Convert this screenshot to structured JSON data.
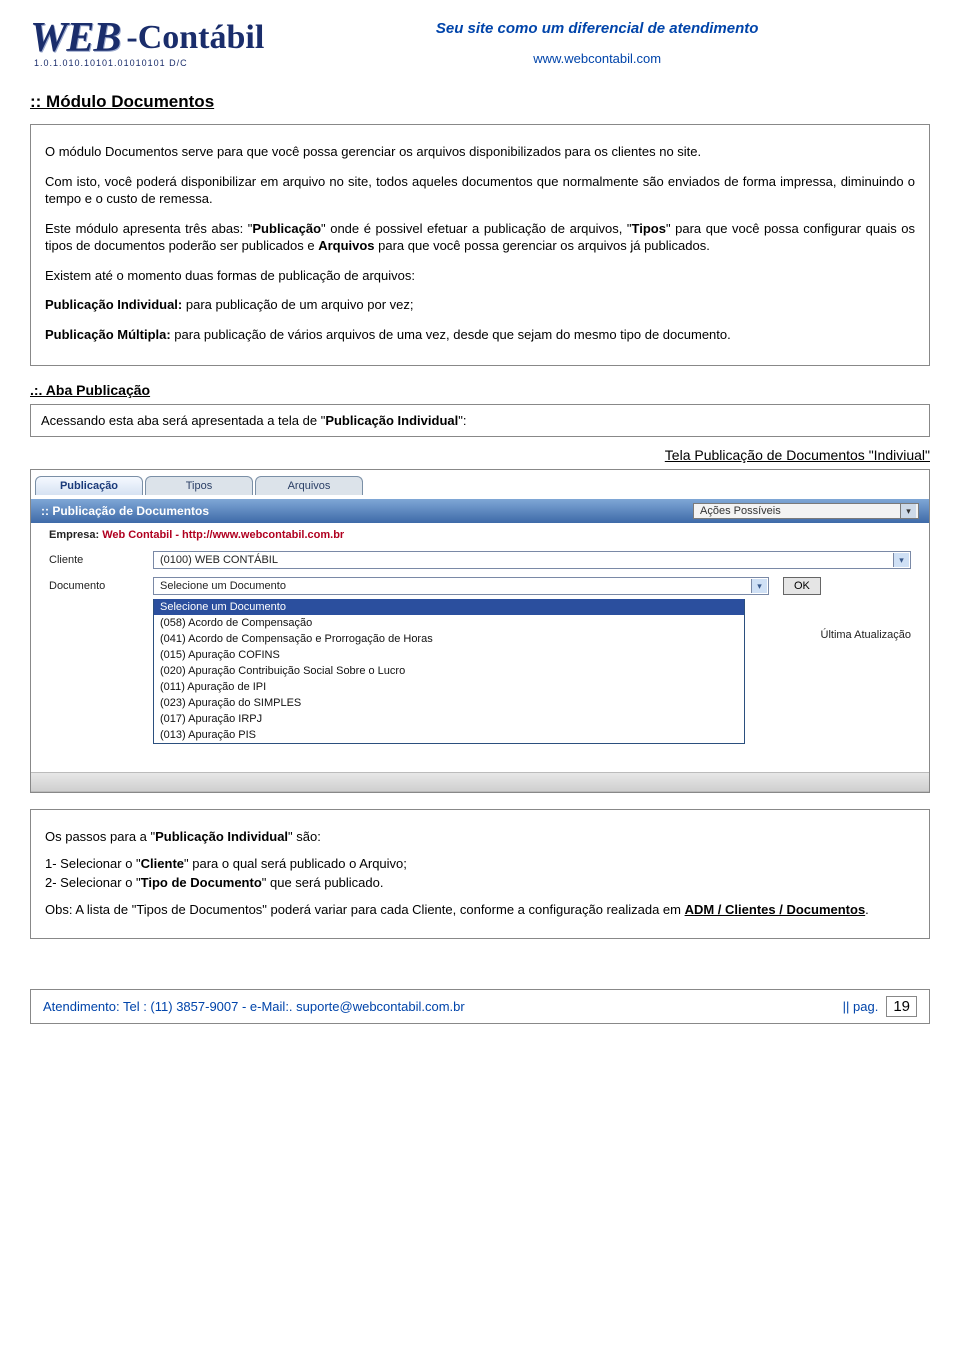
{
  "header": {
    "logo_main": "WEB",
    "logo_suffix": "-Contábil",
    "logo_sub": "1.0.1.010.10101.01010101 D/C",
    "tagline": "Seu site como um diferencial de atendimento",
    "site_url": "www.webcontabil.com"
  },
  "section_title": ":: Módulo Documentos",
  "intro": {
    "p1": "O módulo Documentos serve para que você possa gerenciar os arquivos disponibilizados para os clientes no site.",
    "p2": "Com isto, você poderá disponibilizar em arquivo no site, todos aqueles documentos que normalmente são enviados de forma impressa, diminuindo o tempo e o custo de remessa.",
    "p3_a": "Este módulo apresenta três abas: \"",
    "p3_b": "Publicação",
    "p3_c": "\" onde é  possivel efetuar a publicação de arquivos, \"",
    "p3_d": "Tipos",
    "p3_e": "\" para que você possa configurar quais os tipos de documentos poderão ser publicados e ",
    "p3_f": "Arquivos",
    "p3_g": " para que você possa gerenciar os arquivos já publicados.",
    "p4": "Existem até o momento duas formas de publicação de arquivos:",
    "p5_label": "Publicação Individual:",
    "p5_text": " para publicação de um arquivo por vez;",
    "p6_label": "Publicação Múltipla:",
    "p6_text": " para publicação de vários arquivos de uma vez, desde que sejam do mesmo tipo de documento."
  },
  "aba_title": ".:. Aba Publicação",
  "aba_intro_a": "Acessando esta aba será apresentada a tela de \"",
  "aba_intro_b": "Publicação Individual",
  "aba_intro_c": "\":",
  "screen_caption": "Tela Publicação de Documentos \"Indiviual\"",
  "ui": {
    "tabs": {
      "t1": "Publicação",
      "t2": "Tipos",
      "t3": "Arquivos"
    },
    "bluebar_title": ":: Publicação de Documentos",
    "actions_select": "Ações Possíveis",
    "empresa_label": "Empresa:",
    "empresa_value": "Web Contabil - http://www.webcontabil.com.br",
    "cliente_label": "Cliente",
    "cliente_value": "(0100) WEB CONTÁBIL",
    "documento_label": "Documento",
    "documento_value": "Selecione um Documento",
    "ok_btn": "OK",
    "ultima": "Última Atualização",
    "options": [
      "Selecione um Documento",
      "(058) Acordo de Compensação",
      "(041) Acordo de Compensação e Prorrogação de Horas",
      "(015) Apuração COFINS",
      "(020) Apuração Contribuição Social Sobre o Lucro",
      "(011) Apuração de IPI",
      "(023) Apuração do SIMPLES",
      "(017) Apuração IRPJ",
      "(013) Apuração PIS"
    ]
  },
  "steps": {
    "heading_a": "Os passos para a \"",
    "heading_b": "Publicação Individual",
    "heading_c": "\" são:",
    "s1_a": "1- Selecionar o \"",
    "s1_b": "Cliente",
    "s1_c": "\" para o qual será publicado o Arquivo;",
    "s2_a": "2- Selecionar o \"",
    "s2_b": "Tipo de Documento",
    "s2_c": "\" que será publicado.",
    "obs_a": "Obs: A lista de \"Tipos de Documentos\" poderá variar para cada Cliente, conforme a configuração realizada em ",
    "obs_b": "ADM / Clientes / Documentos",
    "obs_c": "."
  },
  "footer": {
    "contact": "Atendimento:  Tel : (11) 3857-9007 - e-Mail:. suporte@webcontabil.com.br",
    "pag_label": "||  pag.",
    "pag_num": "19"
  }
}
